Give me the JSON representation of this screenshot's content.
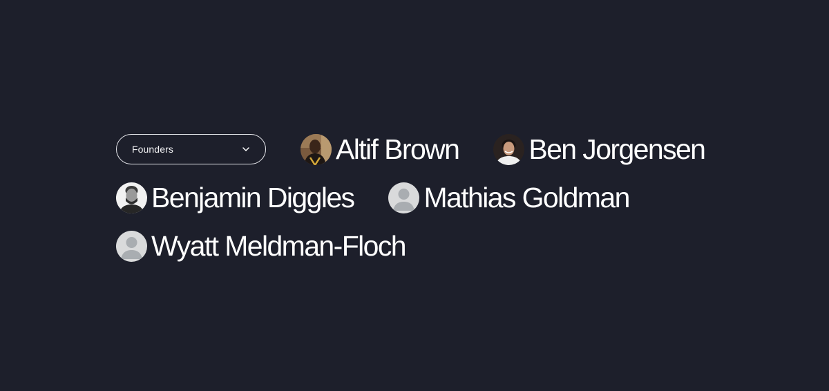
{
  "filter": {
    "selected": "Founders",
    "icon": "chevron-down-icon"
  },
  "people": [
    {
      "name": "Altif Brown",
      "avatar": "photo"
    },
    {
      "name": "Ben Jorgensen",
      "avatar": "photo"
    },
    {
      "name": "Benjamin Diggles",
      "avatar": "photo"
    },
    {
      "name": "Mathias Goldman",
      "avatar": "placeholder"
    },
    {
      "name": "Wyatt Meldman-Floch",
      "avatar": "placeholder"
    }
  ],
  "colors": {
    "background": "#1d1f2b",
    "text": "#ffffff",
    "placeholder_avatar_bg": "#d9dadb",
    "placeholder_avatar_fg": "#a9adb1"
  }
}
